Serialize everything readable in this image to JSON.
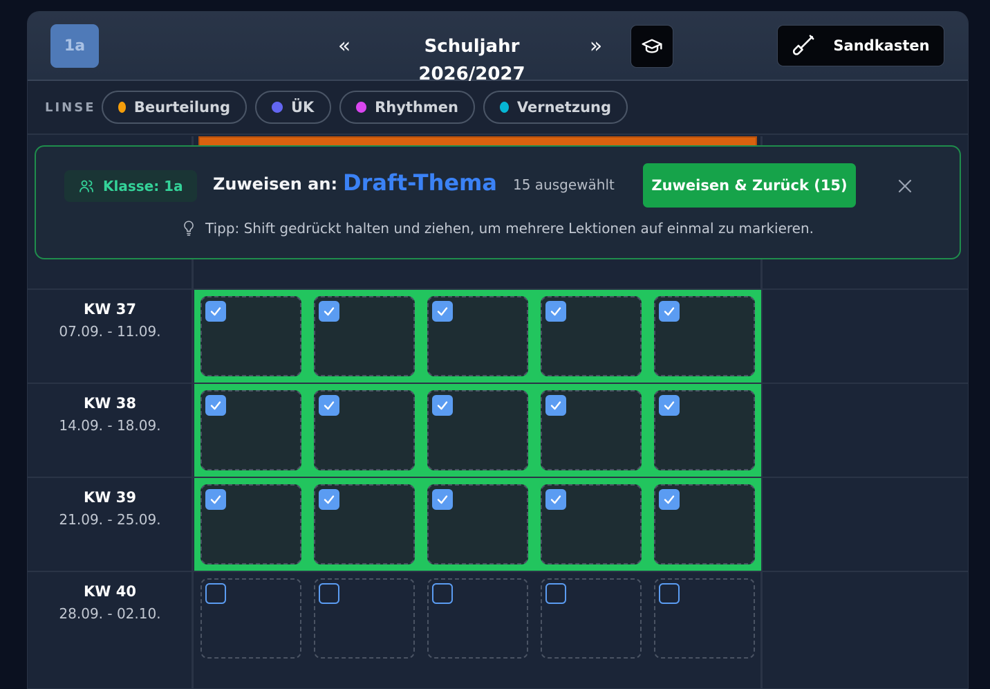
{
  "header": {
    "class_badge": "1a",
    "prev_icon": "double-chevron-left-icon",
    "next_icon": "double-chevron-right-icon",
    "prev_glyph": "«",
    "next_glyph": "»",
    "year_title": "Schuljahr 2026/2027",
    "grad_icon": "graduation-cap-icon",
    "sandbox_label": "Sandkasten",
    "sandbox_icon": "shovel-icon"
  },
  "lens": {
    "label": "LINSE",
    "chips": [
      {
        "label": "Beurteilung",
        "color": "#f59e0b"
      },
      {
        "label": "ÜK",
        "color": "#6366f1"
      },
      {
        "label": "Rhythmen",
        "color": "#d946ef"
      },
      {
        "label": "Vernetzung",
        "color": "#06b6d4"
      }
    ]
  },
  "assign_panel": {
    "klasse": "Klasse: 1a",
    "klasse_icon": "users-icon",
    "label": "Zuweisen an:",
    "target": "Draft-Thema",
    "selected_count": "15 ausgewählt",
    "assign_button": "Zuweisen & Zurück (15)",
    "close_icon": "close-icon",
    "tip_icon": "lightbulb-icon",
    "tip": "Tipp: Shift gedrückt halten und ziehen, um mehrere Lektionen auf einmal zu markieren."
  },
  "weeks": [
    {
      "kw": "KW 37",
      "dates": "07.09. - 11.09.",
      "selected": [
        true,
        true,
        true,
        true,
        true
      ]
    },
    {
      "kw": "KW 38",
      "dates": "14.09. - 18.09.",
      "selected": [
        true,
        true,
        true,
        true,
        true
      ]
    },
    {
      "kw": "KW 39",
      "dates": "21.09. - 25.09.",
      "selected": [
        true,
        true,
        true,
        true,
        true
      ]
    },
    {
      "kw": "KW 40",
      "dates": "28.09. - 02.10.",
      "selected": [
        false,
        false,
        false,
        false,
        false
      ]
    }
  ],
  "colors": {
    "selected_border": "#22c55e",
    "checkbox": "#5b9cf2",
    "accent_blue": "#3b82f6",
    "assign_green": "#16a34a",
    "orange_block": "#d9620f"
  }
}
